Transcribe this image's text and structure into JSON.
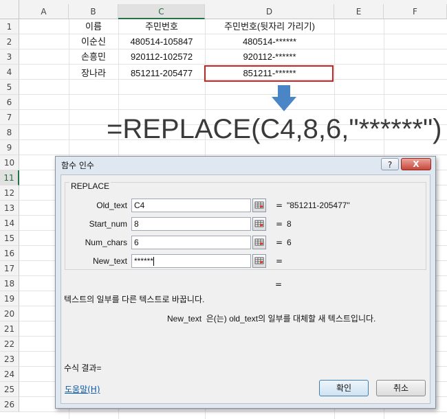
{
  "sheet": {
    "columns": [
      "A",
      "B",
      "C",
      "D",
      "E",
      "F"
    ],
    "rows": [
      "1",
      "2",
      "3",
      "4",
      "5",
      "6",
      "7",
      "8",
      "9",
      "10",
      "11",
      "12",
      "13",
      "14",
      "15",
      "16",
      "17",
      "18",
      "19",
      "20",
      "21",
      "22",
      "23",
      "24",
      "25",
      "26"
    ],
    "header": [
      "이름",
      "주민번호",
      "주민번호(뒷자리 가리기)"
    ],
    "data": [
      [
        "이순신",
        "480514-105847",
        "480514-******"
      ],
      [
        "손흥민",
        "920112-102572",
        "920112-******"
      ],
      [
        "장나라",
        "851211-205477",
        "851211-******"
      ]
    ]
  },
  "formula_text": "=REPLACE(C4,8,6,\"******\")",
  "dialog": {
    "title": "함수 인수",
    "help_button": "?",
    "close_button": "X",
    "function_name": "REPLACE",
    "args": [
      {
        "label": "Old_text",
        "value": "C4",
        "eq": "=",
        "result": "\"851211-205477\""
      },
      {
        "label": "Start_num",
        "value": "8",
        "eq": "=",
        "result": "8"
      },
      {
        "label": "Num_chars",
        "value": "6",
        "eq": "=",
        "result": "6"
      },
      {
        "label": "New_text",
        "value": "******",
        "eq": "=",
        "result": ""
      }
    ],
    "total_eq": "=",
    "description": "텍스트의 일부를 다른 텍스트로 바꿉니다.",
    "arg_description": "New_text  은(는) old_text의 일부를 대체할 새 텍스트입니다.",
    "result_label": "수식 결과=",
    "help_link": "도움말(H)",
    "ok_button": "확인",
    "cancel_button": "취소"
  },
  "colors": {
    "highlight_box": "#d11f1f",
    "arrow": "#4a86c6",
    "excel_green": "#217346"
  }
}
